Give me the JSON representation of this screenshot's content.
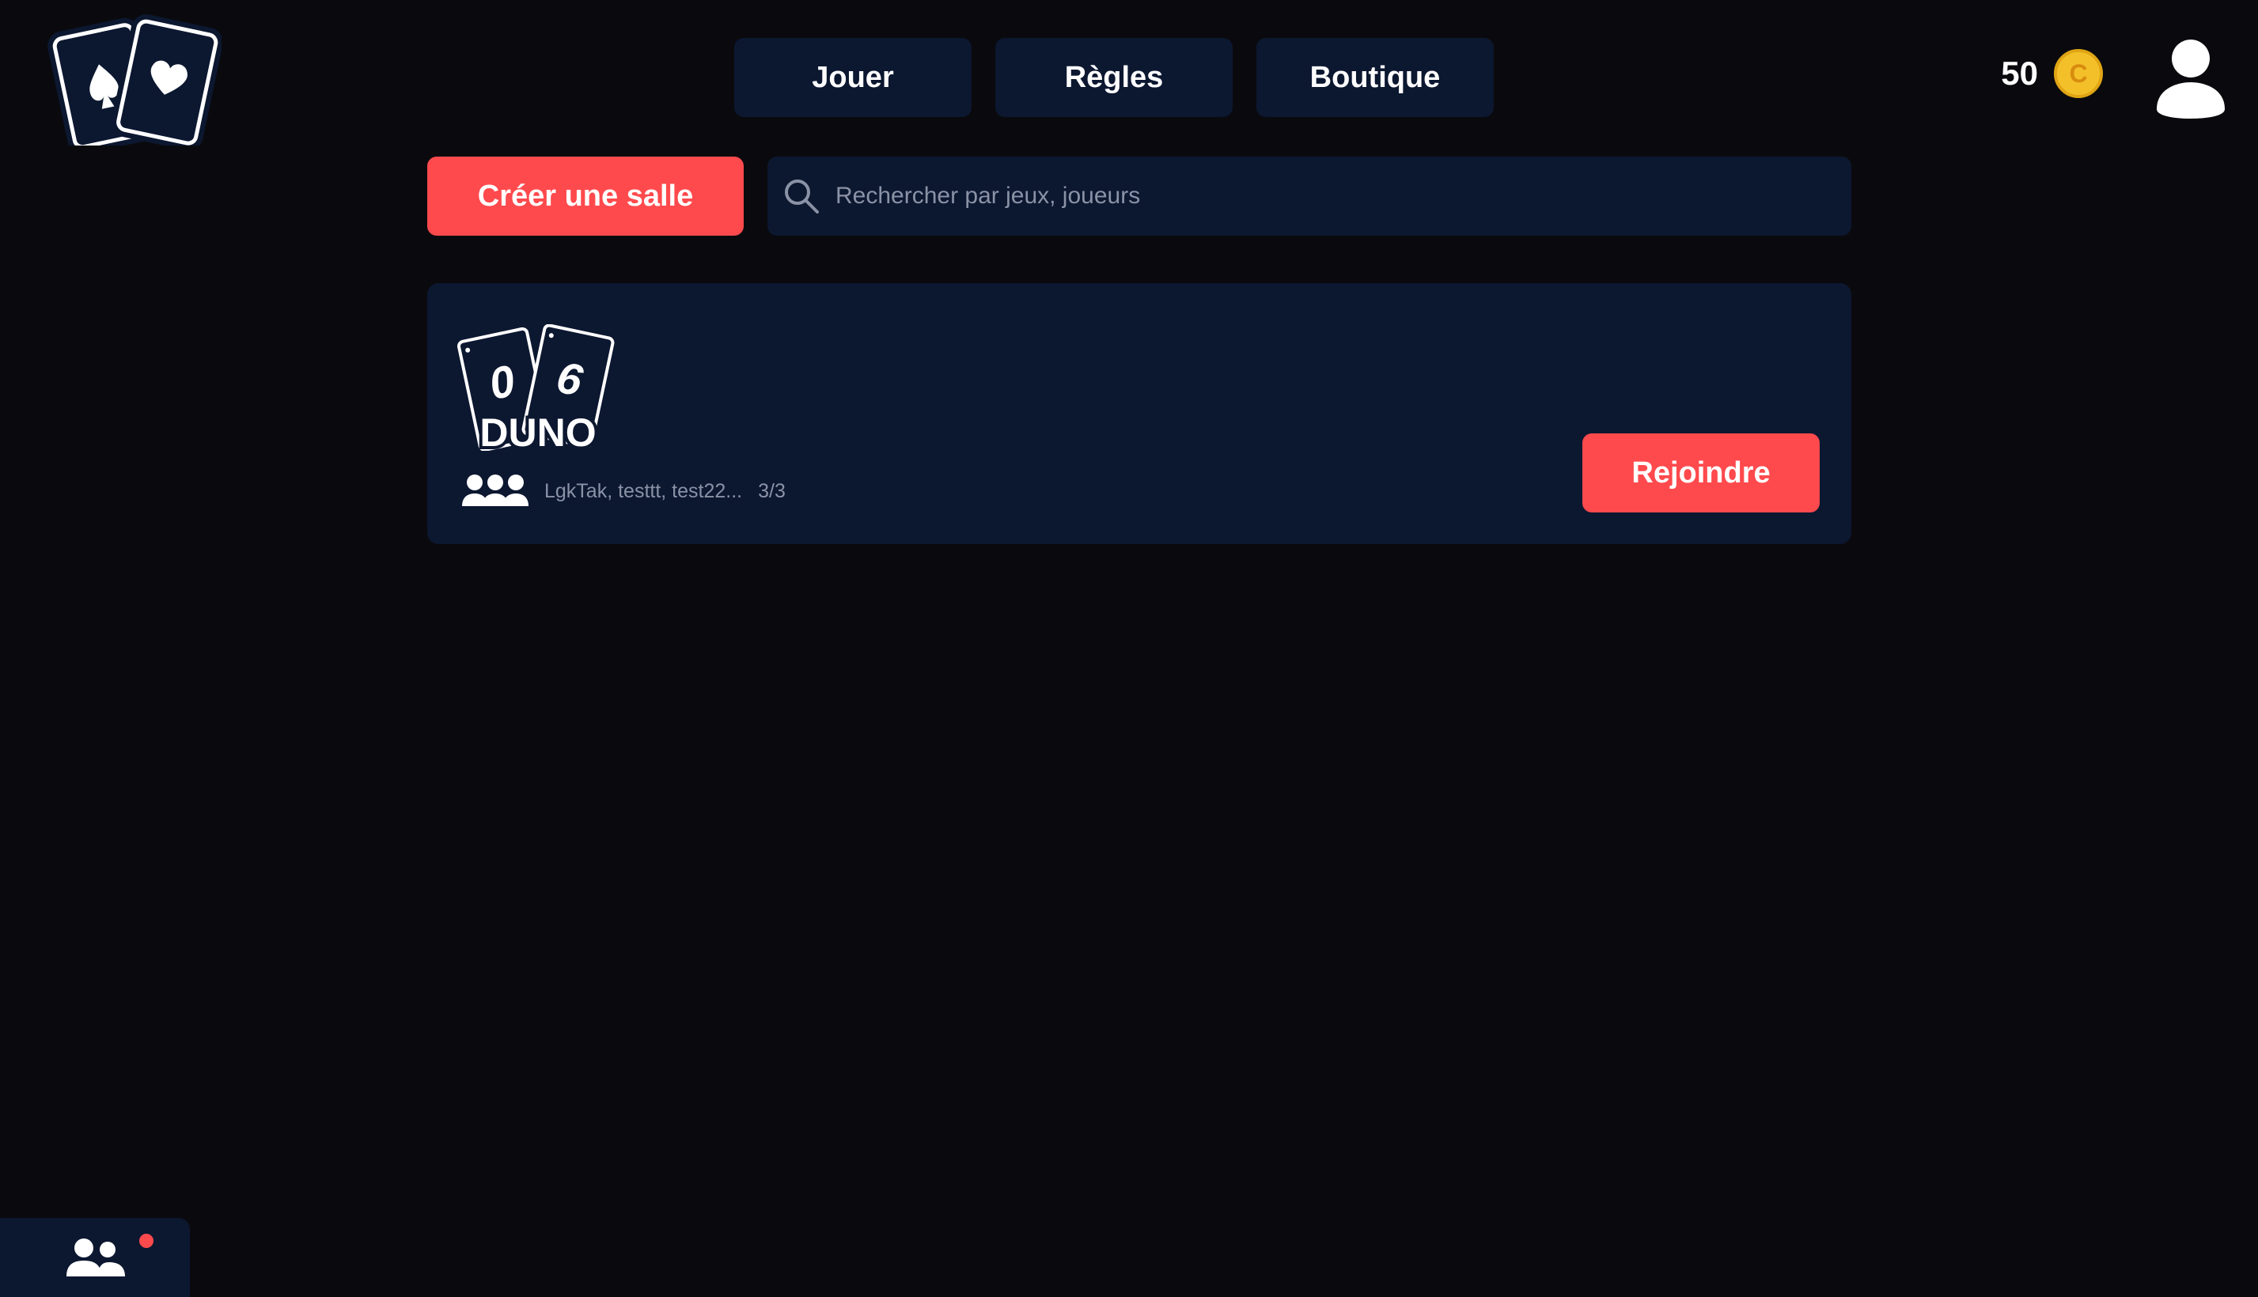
{
  "header": {
    "logo_icon": "playing-cards-logo",
    "nav": [
      {
        "label": "Jouer"
      },
      {
        "label": "Règles"
      },
      {
        "label": "Boutique"
      }
    ],
    "coins": {
      "count": "50",
      "symbol": "C",
      "color": "#f4c02a"
    },
    "avatar_icon": "user-icon"
  },
  "toolbar": {
    "create_label": "Créer une salle",
    "search_placeholder": "Rechercher par jeux, joueurs",
    "search_value": ""
  },
  "rooms": [
    {
      "game_logo_text": "DUNO",
      "card_left_value": "0",
      "card_right_value": "6",
      "players": "LgkTak, testtt, test22...",
      "player_count": "3/3",
      "join_label": "Rejoindre"
    }
  ],
  "friends": {
    "icon": "friends-icon",
    "has_notification": true
  },
  "colors": {
    "background": "#0a0a0e",
    "panel": "#0c1730",
    "accent": "#ff4a4d",
    "muted_text": "#8a92a6",
    "coin": "#f4c02a"
  }
}
